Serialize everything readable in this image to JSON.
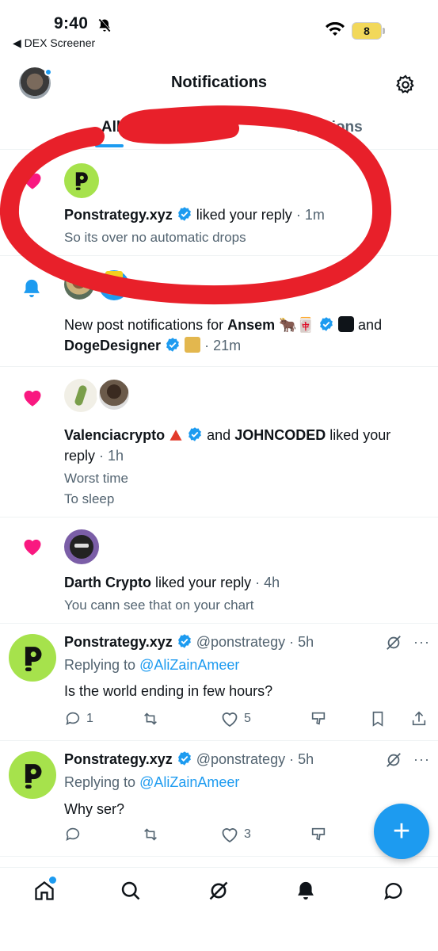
{
  "status_bar": {
    "time": "9:40",
    "back_app": "◀ DEX Screener",
    "battery": "8"
  },
  "header": {
    "title": "Notifications"
  },
  "tabs": [
    {
      "label": "All"
    },
    {
      "label": "Mentions"
    }
  ],
  "notifications": [
    {
      "actor": "Ponstrategy.xyz",
      "action": "liked your reply",
      "time": "· 1m",
      "snippet": "So its over no automatic drops"
    },
    {
      "prefix": "New post notifications for",
      "actor1": "Ansem",
      "emoji1": "🐂",
      "emoji2": "🀄",
      "connector": "and",
      "actor2": "DogeDesigner",
      "time": "· 21m"
    },
    {
      "actor1": "Valenciacrypto",
      "connector": "and",
      "actor2": "JOHNCODED",
      "action1": "liked your",
      "action2": "reply",
      "time": "· 1h",
      "snippet1": "Worst time",
      "snippet2": "To sleep"
    },
    {
      "actor": "Darth Crypto",
      "action": "liked your reply",
      "time": "· 4h",
      "snippet": "You cann see that on your chart"
    }
  ],
  "tweets": [
    {
      "name": "Ponstrategy.xyz",
      "handle": "@ponstrategy",
      "time": "· 5h",
      "replying_prefix": "Replying to",
      "replying_to": "@AliZainAmeer",
      "text": "Is the world ending in few hours?",
      "replies": "1",
      "likes": "5"
    },
    {
      "name": "Ponstrategy.xyz",
      "handle": "@ponstrategy",
      "time": "· 5h",
      "replying_prefix": "Replying to",
      "replying_to": "@AliZainAmeer",
      "text": "Why ser?",
      "replies": "",
      "likes": "3"
    }
  ],
  "fab": {
    "label": "+"
  },
  "colors": {
    "accent": "#1d9bf0",
    "like": "#f91880",
    "pon_green": "#a6e24c",
    "annotation": "#e8202a"
  },
  "icons": [
    "bell-slash-icon",
    "wifi-icon",
    "gear-icon",
    "heart-icon",
    "bell-icon",
    "verified-badge-icon",
    "grok-icon",
    "more-icon",
    "reply-icon",
    "retweet-icon",
    "like-icon",
    "views-icon",
    "bookmark-icon",
    "share-icon",
    "home-icon",
    "search-icon",
    "notifications-icon",
    "messages-icon"
  ]
}
